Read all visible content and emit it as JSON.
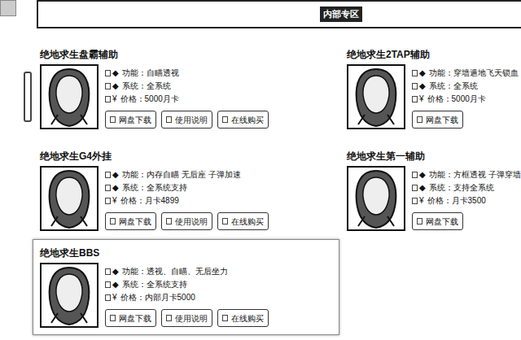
{
  "header": {
    "title": "内部专区"
  },
  "products": [
    {
      "title": "绝地求生盘霸辅助",
      "selected": false,
      "fields": [
        {
          "mark": "◆",
          "label": "功能：",
          "value": "自瞄透视"
        },
        {
          "mark": "◆",
          "label": "系统：",
          "value": "全系统"
        },
        {
          "mark": "¥",
          "label": "价格：",
          "value": "5000月卡"
        }
      ],
      "buttons": [
        "网盘下载",
        "使用说明",
        "在线购买"
      ]
    },
    {
      "title": "绝地求生2TAP辅助",
      "selected": false,
      "fields": [
        {
          "mark": "◆",
          "label": "功能：",
          "value": "穿墙遁地飞天锁血"
        },
        {
          "mark": "◆",
          "label": "系统：",
          "value": "全系统"
        },
        {
          "mark": "¥",
          "label": "价格：",
          "value": "5000月卡"
        }
      ],
      "buttons": [
        "网盘下载"
      ]
    },
    {
      "title": "绝地求生G4外挂",
      "selected": false,
      "fields": [
        {
          "mark": "◆",
          "label": "功能：",
          "value": "内存自瞄 无后座 子弹加速"
        },
        {
          "mark": "◆",
          "label": "系统：",
          "value": "全系统支持"
        },
        {
          "mark": "¥",
          "label": "价格：",
          "value": "月卡4899"
        }
      ],
      "buttons": [
        "网盘下载",
        "使用说明",
        "在线购买"
      ]
    },
    {
      "title": "绝地求生第一辅助",
      "selected": false,
      "fields": [
        {
          "mark": "◆",
          "label": "功能：",
          "value": "方框透视 子弹穿墙"
        },
        {
          "mark": "◆",
          "label": "系统：",
          "value": "支持全系统"
        },
        {
          "mark": "¥",
          "label": "价格：",
          "value": "月卡3500"
        }
      ],
      "buttons": [
        "网盘下载"
      ]
    },
    {
      "title": "绝地求生BBS",
      "selected": true,
      "fields": [
        {
          "mark": "◆",
          "label": "功能：",
          "value": "透视、自瞄、无后坐力"
        },
        {
          "mark": "◆",
          "label": "系统：",
          "value": "全系统支持"
        },
        {
          "mark": "¥",
          "label": "价格：",
          "value": "内部月卡5000"
        }
      ],
      "buttons": [
        "网盘下载",
        "使用说明",
        "在线购买"
      ]
    }
  ]
}
